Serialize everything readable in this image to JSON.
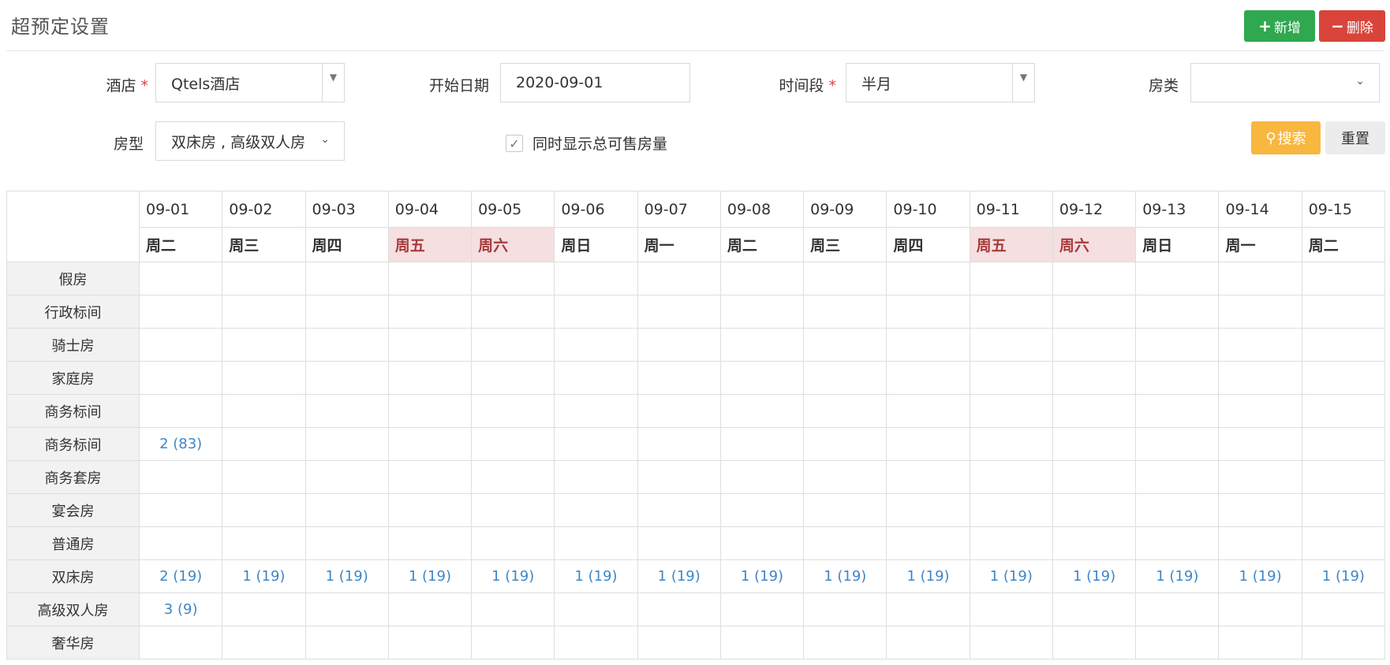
{
  "header": {
    "title": "超预定设置",
    "add_label": "新增",
    "delete_label": "删除"
  },
  "form": {
    "hotel_label": "酒店",
    "hotel_value": "Qtels酒店",
    "start_date_label": "开始日期",
    "start_date_value": "2020-09-01",
    "period_label": "时间段",
    "period_value": "半月",
    "room_category_label": "房类",
    "room_category_value": "",
    "room_type_label": "房型",
    "room_type_value": "双床房 , 高级双人房",
    "show_total_label": "同时显示总可售房量",
    "show_total_checked": true,
    "required_mark": "*",
    "search_label": "搜索",
    "reset_label": "重置"
  },
  "table": {
    "columns": [
      {
        "date": "09-01",
        "day": "周二",
        "weekend": false
      },
      {
        "date": "09-02",
        "day": "周三",
        "weekend": false
      },
      {
        "date": "09-03",
        "day": "周四",
        "weekend": false
      },
      {
        "date": "09-04",
        "day": "周五",
        "weekend": true
      },
      {
        "date": "09-05",
        "day": "周六",
        "weekend": true
      },
      {
        "date": "09-06",
        "day": "周日",
        "weekend": false
      },
      {
        "date": "09-07",
        "day": "周一",
        "weekend": false
      },
      {
        "date": "09-08",
        "day": "周二",
        "weekend": false
      },
      {
        "date": "09-09",
        "day": "周三",
        "weekend": false
      },
      {
        "date": "09-10",
        "day": "周四",
        "weekend": false
      },
      {
        "date": "09-11",
        "day": "周五",
        "weekend": true
      },
      {
        "date": "09-12",
        "day": "周六",
        "weekend": true
      },
      {
        "date": "09-13",
        "day": "周日",
        "weekend": false
      },
      {
        "date": "09-14",
        "day": "周一",
        "weekend": false
      },
      {
        "date": "09-15",
        "day": "周二",
        "weekend": false
      }
    ],
    "rows": [
      {
        "name": "假房",
        "cells": [
          "",
          "",
          "",
          "",
          "",
          "",
          "",
          "",
          "",
          "",
          "",
          "",
          "",
          "",
          ""
        ]
      },
      {
        "name": "行政标间",
        "cells": [
          "",
          "",
          "",
          "",
          "",
          "",
          "",
          "",
          "",
          "",
          "",
          "",
          "",
          "",
          ""
        ]
      },
      {
        "name": "骑士房",
        "cells": [
          "",
          "",
          "",
          "",
          "",
          "",
          "",
          "",
          "",
          "",
          "",
          "",
          "",
          "",
          ""
        ]
      },
      {
        "name": "家庭房",
        "cells": [
          "",
          "",
          "",
          "",
          "",
          "",
          "",
          "",
          "",
          "",
          "",
          "",
          "",
          "",
          ""
        ]
      },
      {
        "name": "商务标间",
        "cells": [
          "",
          "",
          "",
          "",
          "",
          "",
          "",
          "",
          "",
          "",
          "",
          "",
          "",
          "",
          ""
        ]
      },
      {
        "name": "商务标间",
        "cells": [
          "2 (83)",
          "",
          "",
          "",
          "",
          "",
          "",
          "",
          "",
          "",
          "",
          "",
          "",
          "",
          ""
        ]
      },
      {
        "name": "商务套房",
        "cells": [
          "",
          "",
          "",
          "",
          "",
          "",
          "",
          "",
          "",
          "",
          "",
          "",
          "",
          "",
          ""
        ]
      },
      {
        "name": "宴会房",
        "cells": [
          "",
          "",
          "",
          "",
          "",
          "",
          "",
          "",
          "",
          "",
          "",
          "",
          "",
          "",
          ""
        ]
      },
      {
        "name": "普通房",
        "cells": [
          "",
          "",
          "",
          "",
          "",
          "",
          "",
          "",
          "",
          "",
          "",
          "",
          "",
          "",
          ""
        ]
      },
      {
        "name": "双床房",
        "cells": [
          "2 (19)",
          "1 (19)",
          "1 (19)",
          "1 (19)",
          "1 (19)",
          "1 (19)",
          "1 (19)",
          "1 (19)",
          "1 (19)",
          "1 (19)",
          "1 (19)",
          "1 (19)",
          "1 (19)",
          "1 (19)",
          "1 (19)"
        ]
      },
      {
        "name": "高级双人房",
        "cells": [
          "3 (9)",
          "",
          "",
          "",
          "",
          "",
          "",
          "",
          "",
          "",
          "",
          "",
          "",
          "",
          ""
        ]
      },
      {
        "name": "奢华房",
        "cells": [
          "",
          "",
          "",
          "",
          "",
          "",
          "",
          "",
          "",
          "",
          "",
          "",
          "",
          "",
          ""
        ]
      }
    ]
  },
  "colors": {
    "add_button": "#2fa84f",
    "delete_button": "#d9443a",
    "search_button": "#f8b73f",
    "weekend_bg": "#f5dfe1",
    "weekend_text": "#a83a3a",
    "link_text": "#3f86c7"
  },
  "icons": {
    "add": "plus-icon",
    "delete": "minus-icon",
    "search": "search-icon",
    "dropdown": "caret-down-icon",
    "chevron": "chevron-down-icon",
    "checkbox": "check-icon"
  }
}
